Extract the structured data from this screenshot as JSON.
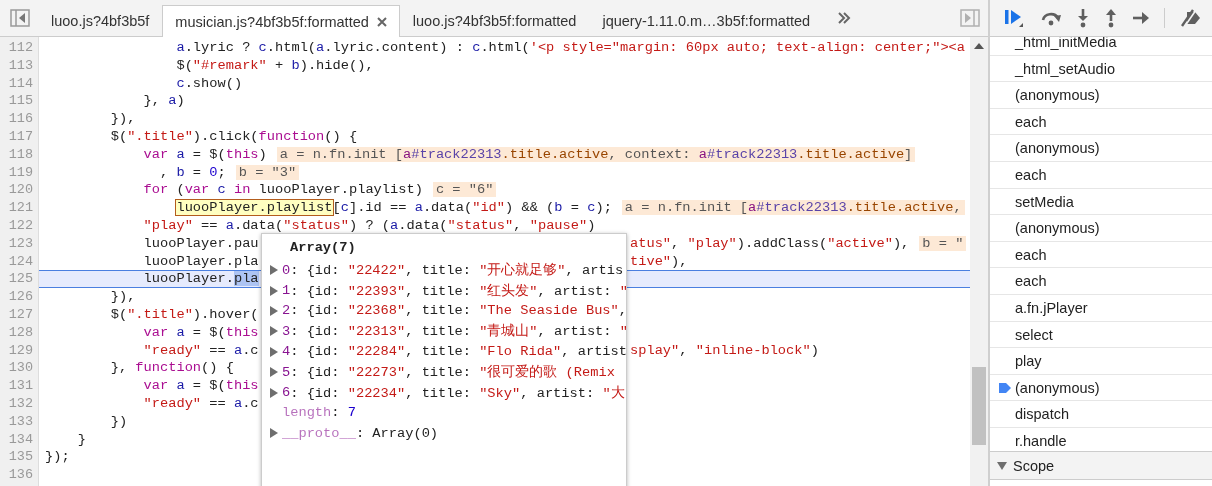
{
  "tabs": [
    {
      "label": "luoo.js?4bf3b5f",
      "selected": false
    },
    {
      "label": "musician.js?4bf3b5f:formatted",
      "selected": true
    },
    {
      "label": "luoo.js?4bf3b5f:formatted",
      "selected": false
    },
    {
      "label": "jquery-1.11.0.m…3b5f:formatted",
      "selected": false
    }
  ],
  "code_lines": [
    {
      "number": "112",
      "current": false,
      "tokens": [
        {
          "text": "                a",
          "kind": "variable"
        },
        {
          "text": ".lyric ? ",
          "kind": "plain"
        },
        {
          "text": "c",
          "kind": "variable"
        },
        {
          "text": ".html(",
          "kind": "plain"
        },
        {
          "text": "a",
          "kind": "variable"
        },
        {
          "text": ".lyric.content) : ",
          "kind": "plain"
        },
        {
          "text": "c",
          "kind": "variable"
        },
        {
          "text": ".html(",
          "kind": "plain"
        },
        {
          "text": "'<p style=\"margin: 60px auto; text-align: center;\"><a",
          "kind": "string"
        }
      ]
    },
    {
      "number": "113",
      "current": false,
      "tokens": [
        {
          "text": "                $(",
          "kind": "plain"
        },
        {
          "text": "\"#remark\"",
          "kind": "string"
        },
        {
          "text": " + ",
          "kind": "plain"
        },
        {
          "text": "b",
          "kind": "variable"
        },
        {
          "text": ").hide(),",
          "kind": "plain"
        }
      ]
    },
    {
      "number": "114",
      "current": false,
      "tokens": [
        {
          "text": "                c",
          "kind": "variable"
        },
        {
          "text": ".show()",
          "kind": "plain"
        }
      ]
    },
    {
      "number": "115",
      "current": false,
      "tokens": [
        {
          "text": "            }, ",
          "kind": "plain"
        },
        {
          "text": "a",
          "kind": "variable"
        },
        {
          "text": ")",
          "kind": "plain"
        }
      ]
    },
    {
      "number": "116",
      "current": false,
      "tokens": [
        {
          "text": "        }),",
          "kind": "plain"
        }
      ]
    },
    {
      "number": "117",
      "current": false,
      "tokens": [
        {
          "text": "        $(",
          "kind": "plain"
        },
        {
          "text": "\".title\"",
          "kind": "string"
        },
        {
          "text": ").click(",
          "kind": "plain"
        },
        {
          "text": "function",
          "kind": "keyword"
        },
        {
          "text": "() {",
          "kind": "plain"
        }
      ]
    },
    {
      "number": "118",
      "current": false,
      "tokens": [
        {
          "text": "            var ",
          "kind": "keyword"
        },
        {
          "text": "a",
          "kind": "variable"
        },
        {
          "text": " = $(",
          "kind": "plain"
        },
        {
          "text": "this",
          "kind": "keyword"
        },
        {
          "text": ")",
          "kind": "plain"
        }
      ],
      "inline": [
        {
          "text": "a = n.fn.init [",
          "kind": "plain"
        },
        {
          "text": "a",
          "kind": "tag"
        },
        {
          "text": "#track22313",
          "kind": "id"
        },
        {
          "text": ".title.active",
          "kind": "class"
        },
        {
          "text": ", context: ",
          "kind": "plain"
        },
        {
          "text": "a",
          "kind": "tag"
        },
        {
          "text": "#track22313",
          "kind": "id"
        },
        {
          "text": ".title.active",
          "kind": "class"
        },
        {
          "text": "]",
          "kind": "plain"
        }
      ]
    },
    {
      "number": "119",
      "current": false,
      "tokens": [
        {
          "text": "              , ",
          "kind": "plain"
        },
        {
          "text": "b",
          "kind": "variable"
        },
        {
          "text": " = ",
          "kind": "plain"
        },
        {
          "text": "0",
          "kind": "number"
        },
        {
          "text": ";",
          "kind": "plain"
        }
      ],
      "inline": [
        {
          "text": "b = \"3\"",
          "kind": "plain"
        }
      ]
    },
    {
      "number": "120",
      "current": false,
      "tokens": [
        {
          "text": "            for",
          "kind": "keyword"
        },
        {
          "text": " (",
          "kind": "plain"
        },
        {
          "text": "var ",
          "kind": "keyword"
        },
        {
          "text": "c",
          "kind": "variable"
        },
        {
          "text": " in",
          "kind": "keyword"
        },
        {
          "text": " luooPlayer.playlist)",
          "kind": "plain"
        }
      ],
      "inline": [
        {
          "text": "c = \"6\"",
          "kind": "plain"
        }
      ]
    },
    {
      "number": "121",
      "current": false,
      "tokens": [
        {
          "text": "                luooPlayer.playlist",
          "kind": "hovered"
        },
        {
          "text": "[",
          "kind": "plain"
        },
        {
          "text": "c",
          "kind": "variable"
        },
        {
          "text": "].id == ",
          "kind": "plain"
        },
        {
          "text": "a",
          "kind": "variable"
        },
        {
          "text": ".data(",
          "kind": "plain"
        },
        {
          "text": "\"id\"",
          "kind": "string"
        },
        {
          "text": ") && (",
          "kind": "plain"
        },
        {
          "text": "b",
          "kind": "variable"
        },
        {
          "text": " = ",
          "kind": "plain"
        },
        {
          "text": "c",
          "kind": "variable"
        },
        {
          "text": ");",
          "kind": "plain"
        }
      ],
      "inline": [
        {
          "text": "a = n.fn.init [",
          "kind": "plain"
        },
        {
          "text": "a",
          "kind": "tag"
        },
        {
          "text": "#track22313",
          "kind": "id"
        },
        {
          "text": ".title.active",
          "kind": "class"
        },
        {
          "text": ",",
          "kind": "plain"
        }
      ]
    },
    {
      "number": "122",
      "current": false,
      "tokens": [
        {
          "text": "            \"play\"",
          "kind": "string"
        },
        {
          "text": " == ",
          "kind": "plain"
        },
        {
          "text": "a",
          "kind": "variable"
        },
        {
          "text": ".data(",
          "kind": "plain"
        },
        {
          "text": "\"status\"",
          "kind": "string"
        },
        {
          "text": ") ? (",
          "kind": "plain"
        },
        {
          "text": "a",
          "kind": "variable"
        },
        {
          "text": ".data(",
          "kind": "plain"
        },
        {
          "text": "\"status\"",
          "kind": "string"
        },
        {
          "text": ", ",
          "kind": "plain"
        },
        {
          "text": "\"pause\"",
          "kind": "string"
        },
        {
          "text": ")",
          "kind": "plain"
        }
      ]
    },
    {
      "number": "123",
      "current": false,
      "tokens": [
        {
          "text": "            luooPlayer.pau",
          "kind": "plain"
        }
      ],
      "tail": [
        {
          "text": "atus\"",
          "kind": "string"
        },
        {
          "text": ", ",
          "kind": "plain"
        },
        {
          "text": "\"play\"",
          "kind": "string"
        },
        {
          "text": ").addClass(",
          "kind": "plain"
        },
        {
          "text": "\"active\"",
          "kind": "string"
        },
        {
          "text": "),",
          "kind": "plain"
        }
      ],
      "tail_inline": [
        {
          "text": "b = \"",
          "kind": "plain"
        }
      ]
    },
    {
      "number": "124",
      "current": false,
      "tokens": [
        {
          "text": "            luooPlayer.pla",
          "kind": "plain"
        }
      ],
      "tail": [
        {
          "text": "tive\"",
          "kind": "string"
        },
        {
          "text": "),",
          "kind": "plain"
        }
      ]
    },
    {
      "number": "125",
      "current": true,
      "tokens": [
        {
          "text": "            luooPlayer.",
          "kind": "plain"
        },
        {
          "text": "pla",
          "kind": "selected"
        }
      ]
    },
    {
      "number": "126",
      "current": false,
      "tokens": [
        {
          "text": "        }),",
          "kind": "plain"
        }
      ]
    },
    {
      "number": "127",
      "current": false,
      "tokens": [
        {
          "text": "        $(",
          "kind": "plain"
        },
        {
          "text": "\".title\"",
          "kind": "string"
        },
        {
          "text": ").hover(",
          "kind": "plain"
        }
      ]
    },
    {
      "number": "128",
      "current": false,
      "tokens": [
        {
          "text": "            var ",
          "kind": "keyword"
        },
        {
          "text": "a",
          "kind": "variable"
        },
        {
          "text": " = $(",
          "kind": "plain"
        },
        {
          "text": "this",
          "kind": "keyword"
        }
      ]
    },
    {
      "number": "129",
      "current": false,
      "tokens": [
        {
          "text": "            \"ready\"",
          "kind": "string"
        },
        {
          "text": " == ",
          "kind": "plain"
        },
        {
          "text": "a",
          "kind": "variable"
        },
        {
          "text": ".c",
          "kind": "plain"
        }
      ],
      "tail": [
        {
          "text": "splay\"",
          "kind": "string"
        },
        {
          "text": ", ",
          "kind": "plain"
        },
        {
          "text": "\"inline-block\"",
          "kind": "string"
        },
        {
          "text": ")",
          "kind": "plain"
        }
      ]
    },
    {
      "number": "130",
      "current": false,
      "tokens": [
        {
          "text": "        }, ",
          "kind": "plain"
        },
        {
          "text": "function",
          "kind": "keyword"
        },
        {
          "text": "() {",
          "kind": "plain"
        }
      ]
    },
    {
      "number": "131",
      "current": false,
      "tokens": [
        {
          "text": "            var ",
          "kind": "keyword"
        },
        {
          "text": "a",
          "kind": "variable"
        },
        {
          "text": " = $(",
          "kind": "plain"
        },
        {
          "text": "this",
          "kind": "keyword"
        }
      ]
    },
    {
      "number": "132",
      "current": false,
      "tokens": [
        {
          "text": "            \"ready\"",
          "kind": "string"
        },
        {
          "text": " == ",
          "kind": "plain"
        },
        {
          "text": "a",
          "kind": "variable"
        },
        {
          "text": ".c",
          "kind": "plain"
        }
      ]
    },
    {
      "number": "133",
      "current": false,
      "tokens": [
        {
          "text": "        })",
          "kind": "plain"
        }
      ]
    },
    {
      "number": "134",
      "current": false,
      "tokens": [
        {
          "text": "    }",
          "kind": "plain"
        }
      ]
    },
    {
      "number": "135",
      "current": false,
      "tokens": [
        {
          "text": "});",
          "kind": "plain"
        }
      ]
    },
    {
      "number": "136",
      "current": false
    }
  ],
  "popup": {
    "title": "Array(7)",
    "properties": [
      {
        "key": "0",
        "expandable": true,
        "dimmed": false,
        "parts": [
          {
            "text": ": {id: ",
            "kind": "plain"
          },
          {
            "text": "\"22422\"",
            "kind": "string"
          },
          {
            "text": ", title: ",
            "kind": "plain"
          },
          {
            "text": "\"开心就足够\"",
            "kind": "string"
          },
          {
            "text": ", artis",
            "kind": "plain"
          }
        ]
      },
      {
        "key": "1",
        "expandable": true,
        "dimmed": false,
        "parts": [
          {
            "text": ": {id: ",
            "kind": "plain"
          },
          {
            "text": "\"22393\"",
            "kind": "string"
          },
          {
            "text": ", title: ",
            "kind": "plain"
          },
          {
            "text": "\"红头发\"",
            "kind": "string"
          },
          {
            "text": ", artist: ",
            "kind": "plain"
          },
          {
            "text": "\"",
            "kind": "string"
          }
        ]
      },
      {
        "key": "2",
        "expandable": true,
        "dimmed": false,
        "parts": [
          {
            "text": ": {id: ",
            "kind": "plain"
          },
          {
            "text": "\"22368\"",
            "kind": "string"
          },
          {
            "text": ", title: ",
            "kind": "plain"
          },
          {
            "text": "\"The Seaside Bus\"",
            "kind": "string"
          },
          {
            "text": ",",
            "kind": "plain"
          }
        ]
      },
      {
        "key": "3",
        "expandable": true,
        "dimmed": false,
        "parts": [
          {
            "text": ": {id: ",
            "kind": "plain"
          },
          {
            "text": "\"22313\"",
            "kind": "string"
          },
          {
            "text": ", title: ",
            "kind": "plain"
          },
          {
            "text": "\"青城山\"",
            "kind": "string"
          },
          {
            "text": ", artist: ",
            "kind": "plain"
          },
          {
            "text": "\"",
            "kind": "string"
          }
        ]
      },
      {
        "key": "4",
        "expandable": true,
        "dimmed": false,
        "parts": [
          {
            "text": ": {id: ",
            "kind": "plain"
          },
          {
            "text": "\"22284\"",
            "kind": "string"
          },
          {
            "text": ", title: ",
            "kind": "plain"
          },
          {
            "text": "\"Flo Rida\"",
            "kind": "string"
          },
          {
            "text": ", artist",
            "kind": "plain"
          }
        ]
      },
      {
        "key": "5",
        "expandable": true,
        "dimmed": false,
        "parts": [
          {
            "text": ": {id: ",
            "kind": "plain"
          },
          {
            "text": "\"22273\"",
            "kind": "string"
          },
          {
            "text": ", title: ",
            "kind": "plain"
          },
          {
            "text": "\"很可爱的歌 (Remix",
            "kind": "string"
          }
        ]
      },
      {
        "key": "6",
        "expandable": true,
        "dimmed": false,
        "parts": [
          {
            "text": ": {id: ",
            "kind": "plain"
          },
          {
            "text": "\"22234\"",
            "kind": "string"
          },
          {
            "text": ", title: ",
            "kind": "plain"
          },
          {
            "text": "\"Sky\"",
            "kind": "string"
          },
          {
            "text": ", artist: ",
            "kind": "plain"
          },
          {
            "text": "\"大",
            "kind": "string"
          }
        ]
      },
      {
        "key": "length",
        "expandable": false,
        "dimmed": true,
        "parts": [
          {
            "text": ": ",
            "kind": "plain"
          },
          {
            "text": "7",
            "kind": "number"
          }
        ]
      },
      {
        "key": "__proto__",
        "expandable": true,
        "dimmed": true,
        "parts": [
          {
            "text": ": Array(0)",
            "kind": "plain"
          }
        ]
      }
    ]
  },
  "call_stack": [
    {
      "name": "_html_initMedia",
      "selected": false
    },
    {
      "name": "_html_setAudio",
      "selected": false
    },
    {
      "name": "(anonymous)",
      "selected": false
    },
    {
      "name": "each",
      "selected": false
    },
    {
      "name": "(anonymous)",
      "selected": false
    },
    {
      "name": "each",
      "selected": false
    },
    {
      "name": "setMedia",
      "selected": false
    },
    {
      "name": "(anonymous)",
      "selected": false
    },
    {
      "name": "each",
      "selected": false
    },
    {
      "name": "each",
      "selected": false
    },
    {
      "name": "a.fn.jPlayer",
      "selected": false
    },
    {
      "name": "select",
      "selected": false
    },
    {
      "name": "play",
      "selected": false
    },
    {
      "name": "(anonymous)",
      "selected": true
    },
    {
      "name": "dispatch",
      "selected": false
    },
    {
      "name": "r.handle",
      "selected": false
    }
  ],
  "scope": {
    "label": "Scope",
    "expanded": true
  }
}
